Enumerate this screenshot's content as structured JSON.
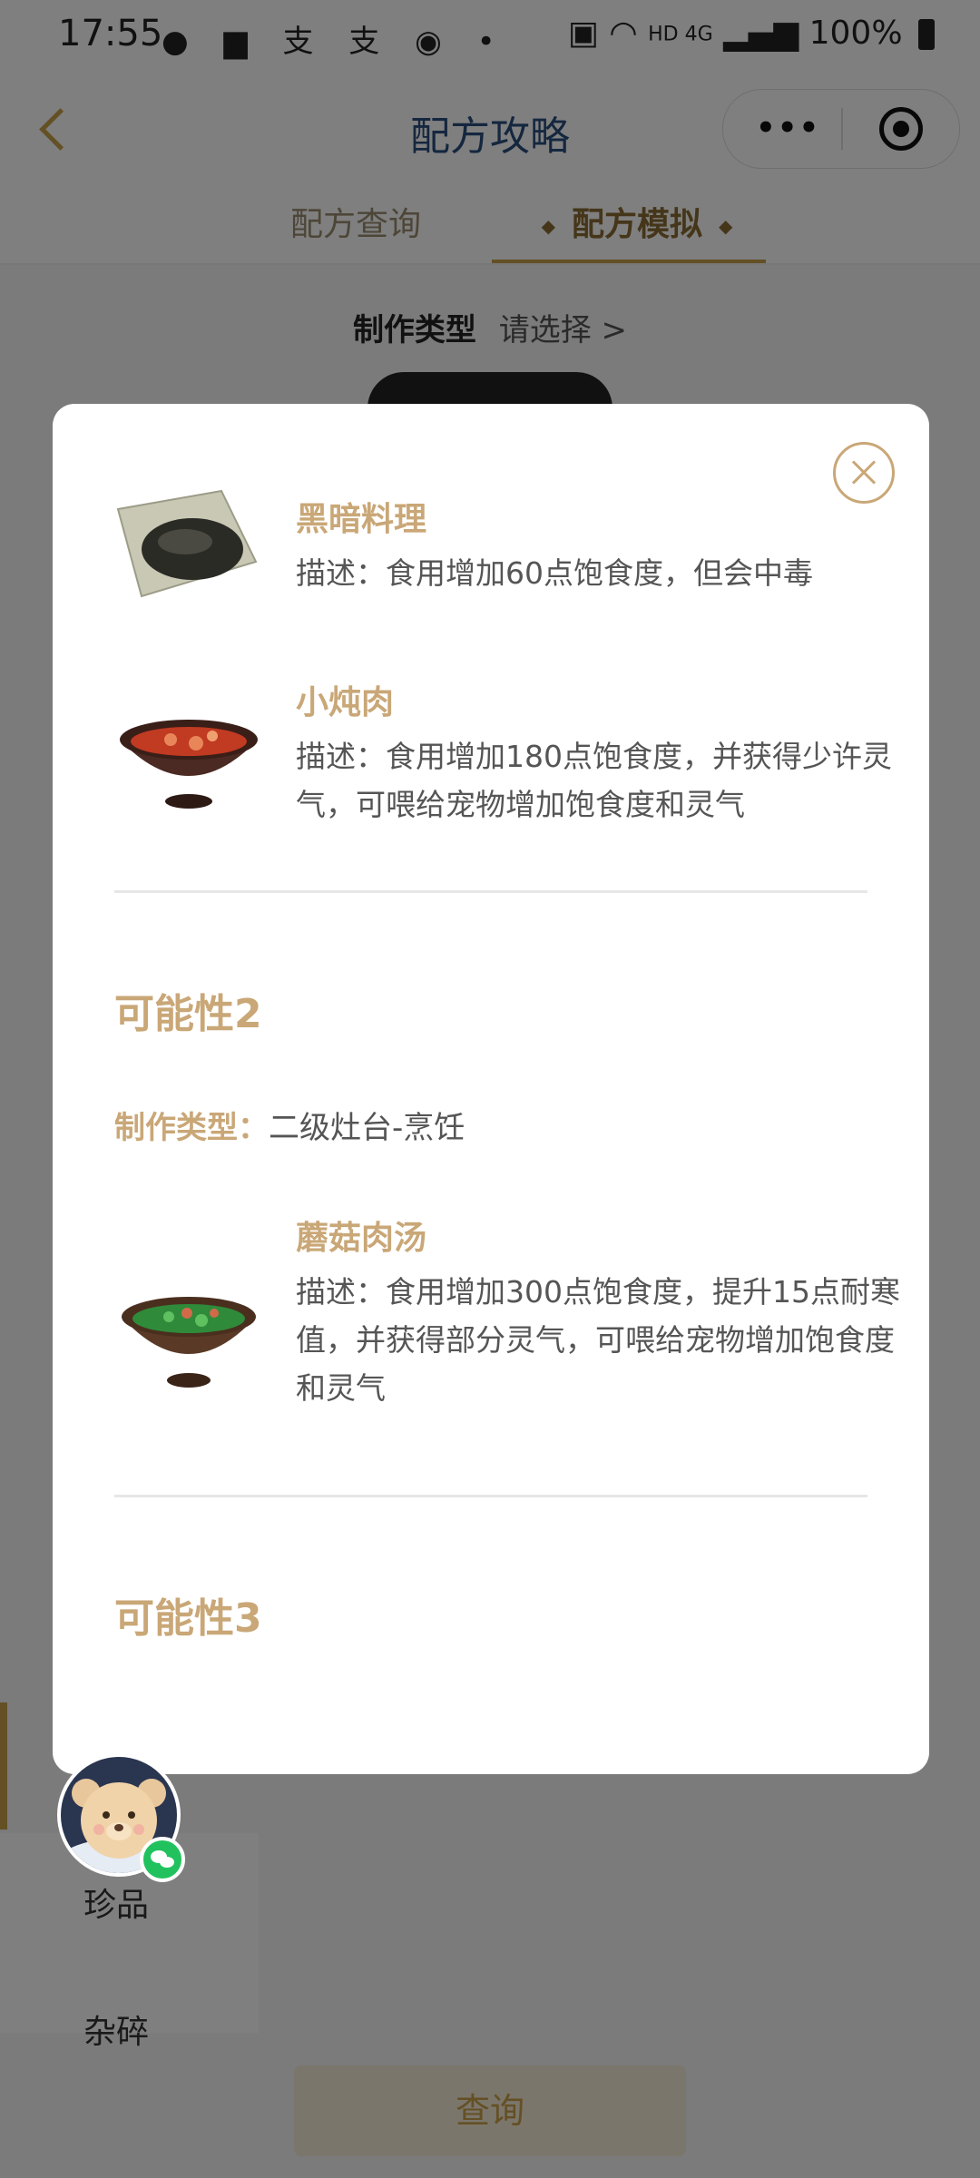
{
  "status_bar": {
    "time": "17:55",
    "notification_icons": [
      "wechat-icon",
      "message-icon",
      "alipay-icon",
      "alipay-icon",
      "app-icon",
      "dot-icon"
    ],
    "network": "HD 4G",
    "battery": "100%"
  },
  "nav": {
    "title": "配方攻略",
    "capsule_more": "•••"
  },
  "tabs": [
    {
      "label": "配方查询",
      "active": false
    },
    {
      "label": "配方模拟",
      "active": true
    }
  ],
  "craft_type": {
    "label": "制作类型",
    "value": "请选择 >"
  },
  "side_list": {
    "items": [
      "珍品",
      "杂碎"
    ]
  },
  "query_button": {
    "label": "查询"
  },
  "modal": {
    "items_top": [
      {
        "name": "黑暗料理",
        "desc": "描述：食用增加60点饱食度，但会中毒"
      },
      {
        "name": "小炖肉",
        "desc": "描述：食用增加180点饱食度，并获得少许灵气，可喂给宠物增加饱食度和灵气"
      }
    ],
    "section2": {
      "title": "可能性2",
      "craft_label": "制作类型：",
      "craft_value": "二级灶台-烹饪",
      "items": [
        {
          "name": "蘑菇肉汤",
          "desc": "描述：食用增加300点饱食度，提升15点耐寒值，并获得部分灵气，可喂给宠物增加饱食度和灵气"
        }
      ]
    },
    "section3": {
      "title": "可能性3"
    }
  },
  "colors": {
    "accent_gold": "#c9a777",
    "nav_title_blue": "#2a4f7f",
    "mask": "rgba(0,0,0,0.5)"
  }
}
